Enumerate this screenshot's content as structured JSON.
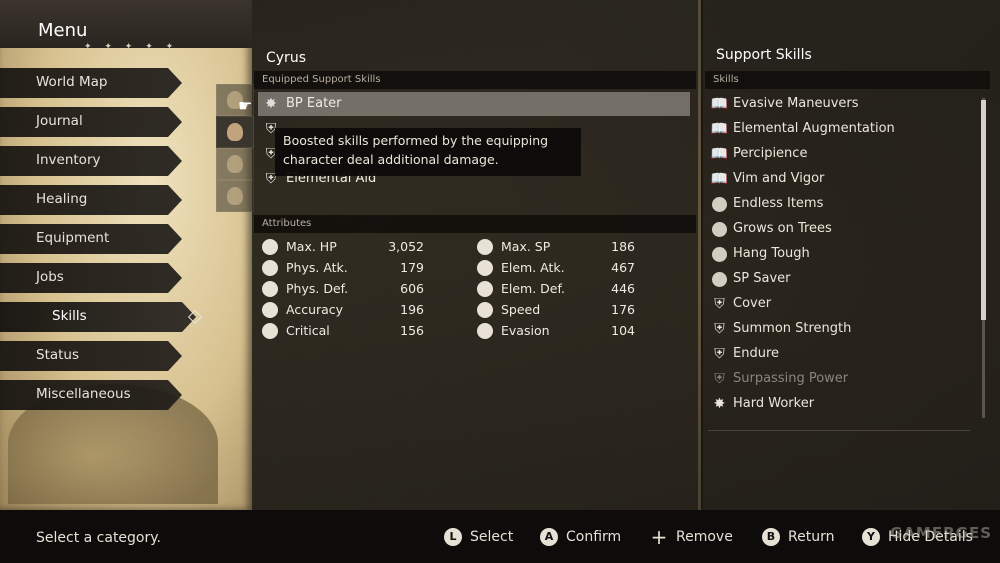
{
  "menu": {
    "title": "Menu",
    "stars": "✦ ✦ ✦ ✦ ✦",
    "items": [
      {
        "label": "World Map"
      },
      {
        "label": "Journal"
      },
      {
        "label": "Inventory"
      },
      {
        "label": "Healing"
      },
      {
        "label": "Equipment"
      },
      {
        "label": "Jobs"
      },
      {
        "label": "Skills",
        "selected": true
      },
      {
        "label": "Status"
      },
      {
        "label": "Miscellaneous"
      }
    ]
  },
  "character": {
    "name": "Cyrus"
  },
  "equipped": {
    "header": "Equipped Support Skills",
    "skills": [
      {
        "label": "BP Eater",
        "icon": "sparkle-icon"
      },
      {
        "label": "",
        "icon": "shield-icon"
      },
      {
        "label": "",
        "icon": "shield-icon"
      },
      {
        "label": "Elemental Aid",
        "icon": "shield-icon"
      }
    ]
  },
  "tooltip": {
    "line1": "Boosted skills performed by the equipping",
    "line2": "character deal additional damage."
  },
  "attributes": {
    "header": "Attributes",
    "left": [
      {
        "name": "Max. HP",
        "value": "3,052",
        "icon": "heart-icon"
      },
      {
        "name": "Phys. Atk.",
        "value": "179",
        "icon": "fist-icon"
      },
      {
        "name": "Phys. Def.",
        "value": "606",
        "icon": "guard-icon"
      },
      {
        "name": "Accuracy",
        "value": "196",
        "icon": "target-icon"
      },
      {
        "name": "Critical",
        "value": "156",
        "icon": "burst-icon"
      }
    ],
    "right": [
      {
        "name": "Max. SP",
        "value": "186",
        "icon": "sp-icon"
      },
      {
        "name": "Elem. Atk.",
        "value": "467",
        "icon": "elem-atk-icon"
      },
      {
        "name": "Elem. Def.",
        "value": "446",
        "icon": "elem-def-icon"
      },
      {
        "name": "Speed",
        "value": "176",
        "icon": "boot-icon"
      },
      {
        "name": "Evasion",
        "value": "104",
        "icon": "evasion-icon"
      }
    ]
  },
  "support": {
    "title": "Support Skills",
    "header": "Skills",
    "skills": [
      {
        "label": "Evasive Maneuvers",
        "icon": "book-icon"
      },
      {
        "label": "Elemental Augmentation",
        "icon": "book-icon"
      },
      {
        "label": "Percipience",
        "icon": "book-icon"
      },
      {
        "label": "Vim and Vigor",
        "icon": "book-icon"
      },
      {
        "label": "Endless Items",
        "icon": "coin-icon"
      },
      {
        "label": "Grows on Trees",
        "icon": "coin-icon"
      },
      {
        "label": "Hang Tough",
        "icon": "coin-icon"
      },
      {
        "label": "SP Saver",
        "icon": "coin-icon"
      },
      {
        "label": "Cover",
        "icon": "shield-icon"
      },
      {
        "label": "Summon Strength",
        "icon": "shield-icon"
      },
      {
        "label": "Endure",
        "icon": "shield-icon"
      },
      {
        "label": "Surpassing Power",
        "icon": "shield-icon",
        "dim": true
      },
      {
        "label": "Hard Worker",
        "icon": "sparkle-icon"
      }
    ]
  },
  "footer": {
    "hint": "Select a category.",
    "controls": [
      {
        "button": "L",
        "label": "Select"
      },
      {
        "button": "A",
        "label": "Confirm"
      },
      {
        "button": "+",
        "label": "Remove"
      },
      {
        "button": "B",
        "label": "Return"
      },
      {
        "button": "Y",
        "label": "Hide Details"
      }
    ],
    "watermark": "GAMERGES"
  }
}
